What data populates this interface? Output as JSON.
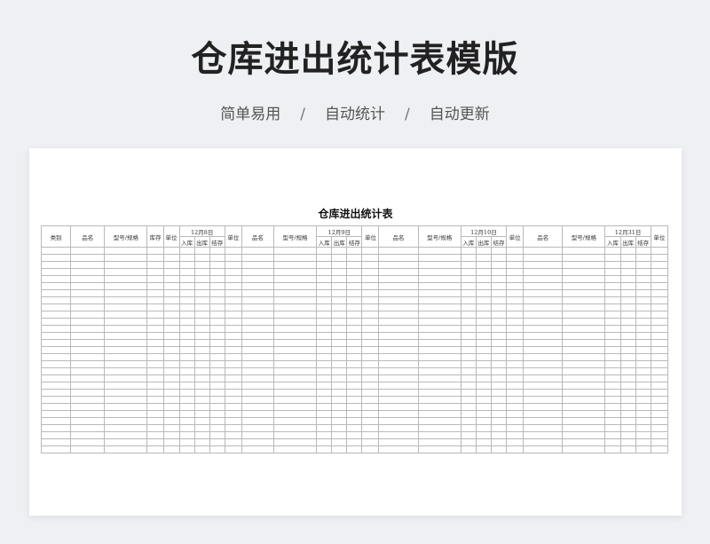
{
  "banner": {
    "title": "仓库进出统计表模版",
    "features": [
      "简单易用",
      "自动统计",
      "自动更新"
    ],
    "separator": "/"
  },
  "sheet": {
    "title": "仓库进出统计表",
    "headers": {
      "category": "类别",
      "name": "品名",
      "model": "型号/规格",
      "stock": "库存",
      "unit": "单位",
      "in": "入库",
      "out": "出库",
      "balance": "结存"
    },
    "dates": [
      "12月8日",
      "12月9日",
      "12月10日",
      "12月31日"
    ],
    "row_count": 29
  }
}
